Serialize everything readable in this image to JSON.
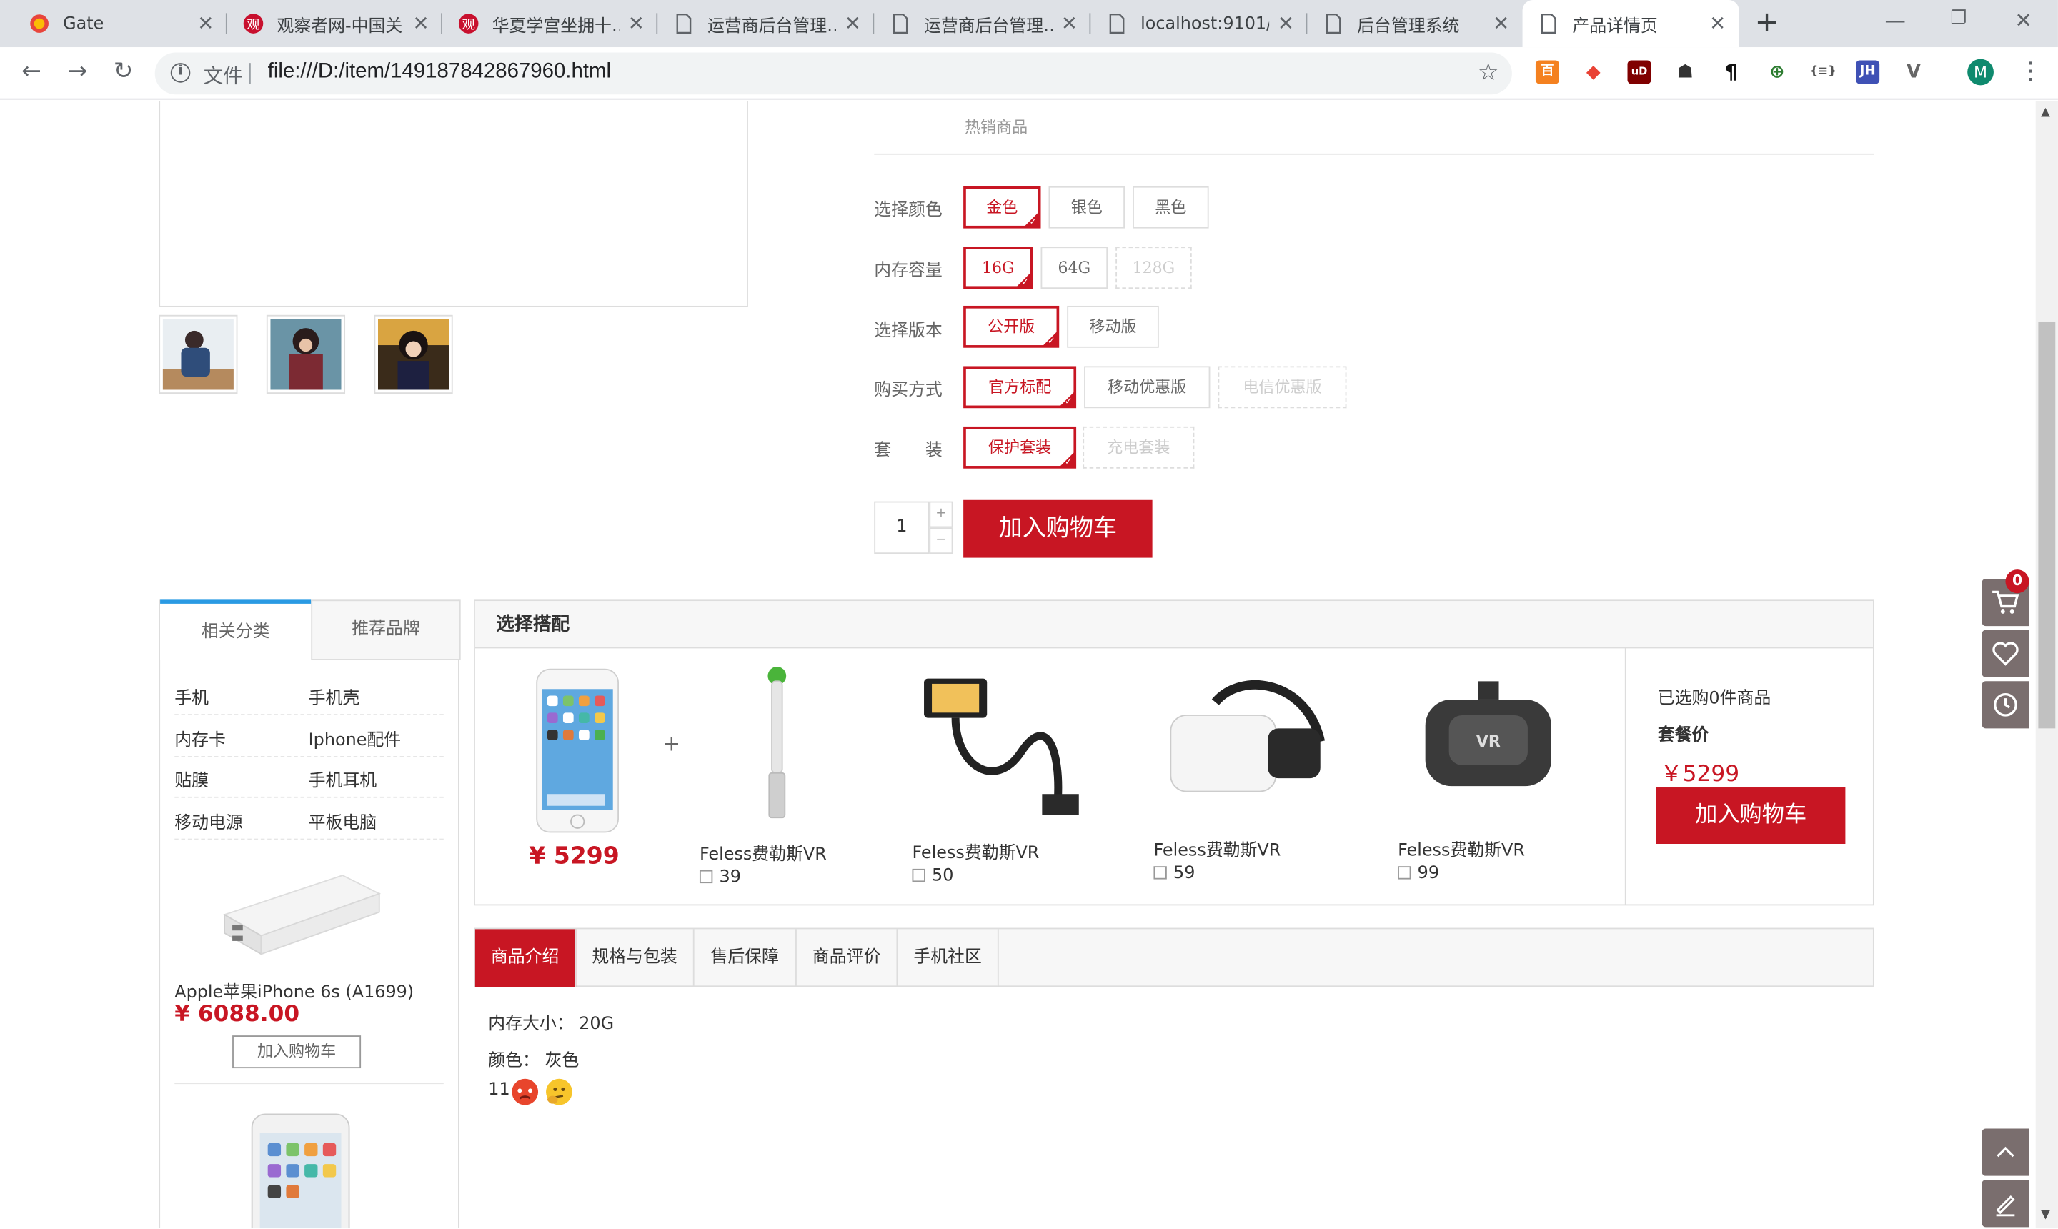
{
  "browser": {
    "tabs": [
      {
        "title": "Gate",
        "icon": "gate-icon"
      },
      {
        "title": "观察者网-中国关",
        "icon": "guancha-icon"
      },
      {
        "title": "华夏学宫坐拥十…",
        "icon": "guancha-icon"
      },
      {
        "title": "运营商后台管理…",
        "icon": "page-icon"
      },
      {
        "title": "运营商后台管理…",
        "icon": "page-icon"
      },
      {
        "title": "localhost:9101/…",
        "icon": "page-icon"
      },
      {
        "title": "后台管理系统",
        "icon": "page-icon"
      },
      {
        "title": "产品详情页",
        "icon": "page-icon"
      }
    ],
    "active_tab": 7,
    "url_scheme": "文件",
    "url": "file:///D:/item/149187842867960.html",
    "profile_initial": "M",
    "extensions": [
      "百",
      "◆",
      "uD",
      "☗",
      "¶",
      "⊕",
      "{≡}",
      "JH",
      "V"
    ]
  },
  "product": {
    "hot_label": "热销商品",
    "options": [
      {
        "label": "选择颜色",
        "values": [
          "金色",
          "银色",
          "黑色"
        ],
        "selected": 0,
        "disabled": []
      },
      {
        "label": "内存容量",
        "values": [
          "16G",
          "64G",
          "128G"
        ],
        "selected": 0,
        "disabled": [
          2
        ]
      },
      {
        "label": "选择版本",
        "values": [
          "公开版",
          "移动版"
        ],
        "selected": 0,
        "disabled": []
      },
      {
        "label": "购买方式",
        "values": [
          "官方标配",
          "移动优惠版",
          "电信优惠版"
        ],
        "selected": 0,
        "disabled": [
          2
        ]
      },
      {
        "label": "套　　装",
        "values": [
          "保护套装",
          "充电套装"
        ],
        "selected": 0,
        "disabled": [
          1
        ]
      }
    ],
    "quantity": "1",
    "qty_plus": "+",
    "qty_minus": "−",
    "add_to_cart": "加入购物车"
  },
  "sidebar": {
    "tab_related": "相关分类",
    "tab_brands": "推荐品牌",
    "categories": [
      "手机",
      "手机壳",
      "内存卡",
      "Iphone配件",
      "贴膜",
      "手机耳机",
      "移动电源",
      "平板电脑"
    ],
    "product_name": "Apple苹果iPhone 6s (A1699)",
    "product_price": "¥ 6088.00",
    "add_button": "加入购物车"
  },
  "combo": {
    "title": "选择搭配",
    "main_price": "¥ 5299",
    "plus": "+",
    "items": [
      {
        "name": "Feless费勒斯VR",
        "price": "39"
      },
      {
        "name": "Feless费勒斯VR",
        "price": "50"
      },
      {
        "name": "Feless费勒斯VR",
        "price": "59"
      },
      {
        "name": "Feless费勒斯VR",
        "price": "99"
      }
    ],
    "selected_text": "已选购0件商品",
    "package_label": "套餐价",
    "package_price": "￥5299",
    "add_button": "加入购物车"
  },
  "detail": {
    "tabs": [
      "商品介绍",
      "规格与包装",
      "售后保障",
      "商品评价",
      "手机社区"
    ],
    "active": 0,
    "lines": [
      "内存大小： 20G",
      "颜色： 灰色",
      "11"
    ]
  },
  "right_toolbar": {
    "cart_count": "0"
  },
  "colors": {
    "accent": "#c81623",
    "tab_highlight": "#2a9ae3",
    "toolbar_bg": "#7a6e6e"
  }
}
